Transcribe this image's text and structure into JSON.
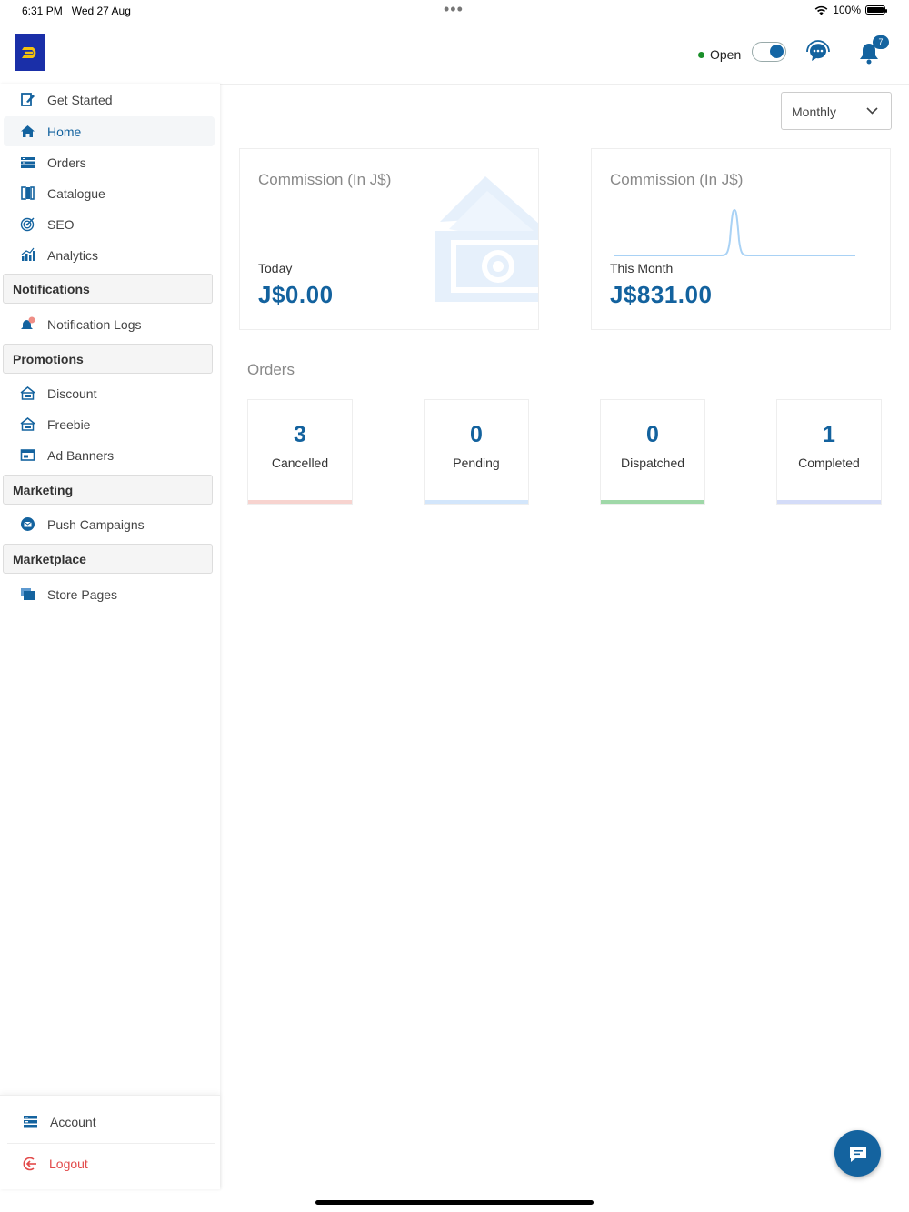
{
  "status_bar": {
    "time": "6:31 PM",
    "date": "Wed 27 Aug",
    "battery": "100%"
  },
  "header": {
    "open_label": "Open",
    "notification_count": "7",
    "accent_color": "#14639f"
  },
  "sidebar": {
    "items": [
      {
        "label": "Get Started",
        "icon": "edit-icon"
      },
      {
        "label": "Home",
        "icon": "home-icon",
        "active": true
      },
      {
        "label": "Orders",
        "icon": "orders-icon"
      },
      {
        "label": "Catalogue",
        "icon": "catalogue-icon"
      },
      {
        "label": "SEO",
        "icon": "target-icon"
      },
      {
        "label": "Analytics",
        "icon": "analytics-icon"
      }
    ],
    "sections": {
      "notifications": {
        "title": "Notifications",
        "items": [
          {
            "label": "Notification Logs",
            "icon": "notification-bell-icon"
          }
        ]
      },
      "promotions": {
        "title": "Promotions",
        "items": [
          {
            "label": "Discount",
            "icon": "discount-icon"
          },
          {
            "label": "Freebie",
            "icon": "freebie-icon"
          },
          {
            "label": "Ad Banners",
            "icon": "banner-icon"
          }
        ]
      },
      "marketing": {
        "title": "Marketing",
        "items": [
          {
            "label": "Push Campaigns",
            "icon": "mail-icon"
          }
        ]
      },
      "marketplace": {
        "title": "Marketplace",
        "items": [
          {
            "label": "Store Pages",
            "icon": "pages-icon"
          }
        ]
      }
    },
    "footer": {
      "account_label": "Account",
      "logout_label": "Logout"
    }
  },
  "main": {
    "period_select": {
      "value": "Monthly"
    },
    "commission_today": {
      "title": "Commission (In J$)",
      "period_label": "Today",
      "value": "J$0.00"
    },
    "commission_month": {
      "title": "Commission (In J$)",
      "period_label": "This Month",
      "value": "J$831.00"
    },
    "orders_title": "Orders",
    "order_stats": [
      {
        "count": "3",
        "label": "Cancelled",
        "color": "#f7d3cf"
      },
      {
        "count": "0",
        "label": "Pending",
        "color": "#d3e6fb"
      },
      {
        "count": "0",
        "label": "Dispatched",
        "color": "#9fd8a8"
      },
      {
        "count": "1",
        "label": "Completed",
        "color": "#d4dcf8"
      }
    ]
  }
}
